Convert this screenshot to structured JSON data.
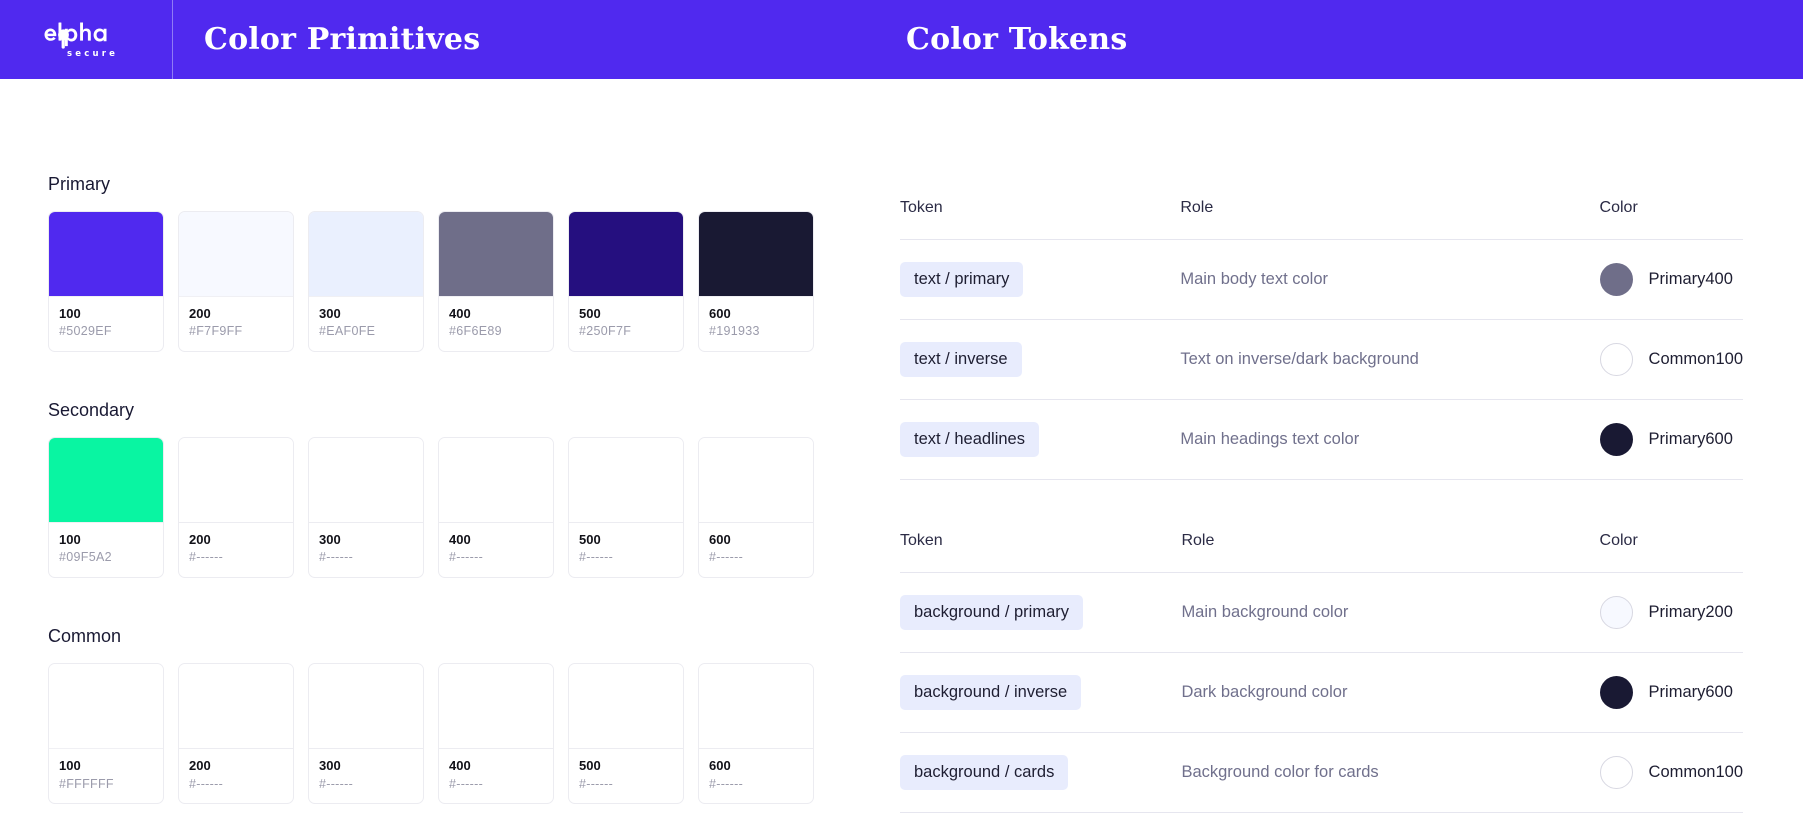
{
  "header": {
    "logo_name": "elpha",
    "logo_sub": "secure",
    "title_primitives": "Color Primitives",
    "title_tokens": "Color Tokens",
    "bar_color": "#5029EF"
  },
  "primitives": {
    "groups": [
      {
        "name": "Primary",
        "swatches": [
          {
            "step": "100",
            "hex": "#5029EF",
            "color": "#5029EF",
            "filled": true
          },
          {
            "step": "200",
            "hex": "#F7F9FF",
            "color": "#F7F9FF",
            "filled": true
          },
          {
            "step": "300",
            "hex": "#EAF0FE",
            "color": "#EAF0FE",
            "filled": true
          },
          {
            "step": "400",
            "hex": "#6F6E89",
            "color": "#6F6E89",
            "filled": true
          },
          {
            "step": "500",
            "hex": "#250F7F",
            "color": "#250F7F",
            "filled": true
          },
          {
            "step": "600",
            "hex": "#191933",
            "color": "#191933",
            "filled": true
          }
        ]
      },
      {
        "name": "Secondary",
        "swatches": [
          {
            "step": "100",
            "hex": "#09F5A2",
            "color": "#09F5A2",
            "filled": true
          },
          {
            "step": "200",
            "hex": "#------",
            "color": "",
            "filled": false
          },
          {
            "step": "300",
            "hex": "#------",
            "color": "",
            "filled": false
          },
          {
            "step": "400",
            "hex": "#------",
            "color": "",
            "filled": false
          },
          {
            "step": "500",
            "hex": "#------",
            "color": "",
            "filled": false
          },
          {
            "step": "600",
            "hex": "#------",
            "color": "",
            "filled": false
          }
        ]
      },
      {
        "name": "Common",
        "swatches": [
          {
            "step": "100",
            "hex": "#FFFFFF",
            "color": "#FFFFFF",
            "filled": true
          },
          {
            "step": "200",
            "hex": "#------",
            "color": "",
            "filled": false
          },
          {
            "step": "300",
            "hex": "#------",
            "color": "",
            "filled": false
          },
          {
            "step": "400",
            "hex": "#------",
            "color": "",
            "filled": false
          },
          {
            "step": "500",
            "hex": "#------",
            "color": "",
            "filled": false
          },
          {
            "step": "600",
            "hex": "#------",
            "color": "",
            "filled": false
          }
        ]
      }
    ]
  },
  "tokens": {
    "tables": [
      {
        "columns": [
          "Token",
          "Role",
          "Color"
        ],
        "rows": [
          {
            "token": "text / primary",
            "role": "Main body text color",
            "color_name": "Primary400",
            "color_value": "#6F6E89",
            "outlined": false
          },
          {
            "token": "text / inverse",
            "role": "Text on inverse/dark background",
            "color_name": "Common100",
            "color_value": "#FFFFFF",
            "outlined": true
          },
          {
            "token": "text / headlines",
            "role": "Main headings text color",
            "color_name": "Primary600",
            "color_value": "#191933",
            "outlined": false
          }
        ]
      },
      {
        "columns": [
          "Token",
          "Role",
          "Color"
        ],
        "rows": [
          {
            "token": "background / primary",
            "role": "Main background color",
            "color_name": "Primary200",
            "color_value": "#F7F9FF",
            "outlined": true
          },
          {
            "token": "background / inverse",
            "role": "Dark background color",
            "color_name": "Primary600",
            "color_value": "#191933",
            "outlined": false
          },
          {
            "token": "background / cards",
            "role": "Background color for cards",
            "color_name": "Common100",
            "color_value": "#FFFFFF",
            "outlined": true
          }
        ]
      }
    ]
  }
}
